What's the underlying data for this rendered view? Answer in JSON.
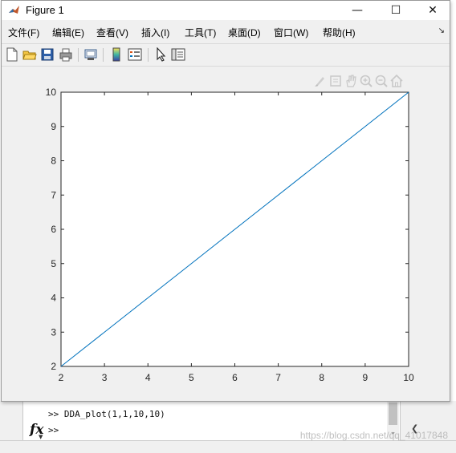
{
  "window": {
    "title": "Figure 1",
    "minimize_glyph": "—",
    "maximize_glyph": "☐",
    "close_glyph": "✕"
  },
  "menu": {
    "items": [
      {
        "label": "文件(F)"
      },
      {
        "label": "编辑(E)"
      },
      {
        "label": "查看(V)"
      },
      {
        "label": "插入(I)"
      },
      {
        "label": "工具(T)"
      },
      {
        "label": "桌面(D)"
      },
      {
        "label": "窗口(W)"
      },
      {
        "label": "帮助(H)"
      }
    ],
    "overflow_glyph": "↘"
  },
  "toolbar": {
    "icons": [
      "new-figure-icon",
      "open-file-icon",
      "save-icon",
      "print-icon",
      "print-preview-icon",
      "colorbar-icon",
      "legend-icon",
      "select-arrow-icon",
      "property-inspector-icon"
    ]
  },
  "axes_toolbar": {
    "icons": [
      "brush-icon",
      "datatip-icon",
      "pan-icon",
      "zoom-in-icon",
      "zoom-out-icon",
      "home-icon"
    ]
  },
  "chart_data": {
    "type": "line",
    "x": [
      2,
      10
    ],
    "y": [
      2,
      10
    ],
    "xlim": [
      2,
      10
    ],
    "ylim": [
      2,
      10
    ],
    "xticks": [
      "2",
      "3",
      "4",
      "5",
      "6",
      "7",
      "8",
      "9",
      "10"
    ],
    "yticks": [
      "2",
      "3",
      "4",
      "5",
      "6",
      "7",
      "8",
      "9",
      "10"
    ],
    "line_color": "#0072BD",
    "grid": false,
    "title": "",
    "xlabel": "",
    "ylabel": ""
  },
  "command_window": {
    "history_line": ">> DDA_plot(1,1,10,10)",
    "prompt": ">>",
    "fx_label": "fx"
  },
  "watermark": "https://blog.csdn.net/qq_41017848"
}
